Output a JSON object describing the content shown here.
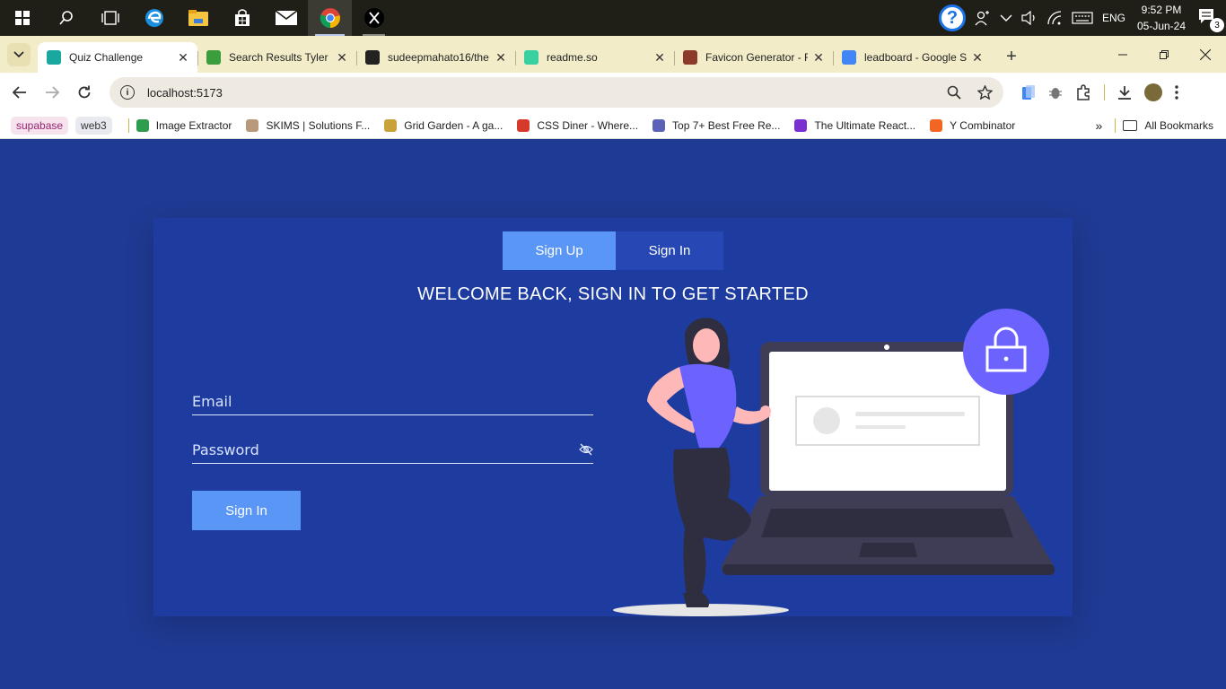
{
  "taskbar": {
    "apps": [
      "start-icon",
      "search-icon",
      "task-view-icon",
      "edge-icon",
      "file-explorer-icon",
      "store-icon",
      "mail-icon",
      "chrome-icon",
      "x-icon"
    ],
    "language": "ENG",
    "time": "9:52 PM",
    "date": "05-Jun-24",
    "notification_count": "3"
  },
  "tabs": [
    {
      "title": "Quiz Challenge",
      "active": true,
      "favicon_color": "#19a8a0"
    },
    {
      "title": "Search Results Tyler P",
      "active": false,
      "favicon_color": "#3c9d3c"
    },
    {
      "title": "sudeepmahato16/the",
      "active": false,
      "favicon_color": "#222222"
    },
    {
      "title": "readme.so",
      "active": false,
      "favicon_color": "#3ad0a0"
    },
    {
      "title": "Favicon Generator - F",
      "active": false,
      "favicon_color": "#8b3a2b"
    },
    {
      "title": "leadboard - Google S",
      "active": false,
      "favicon_color": "#4285f4"
    }
  ],
  "address": {
    "url": "localhost:5173"
  },
  "bookmarks": {
    "chips": [
      "supabase",
      "web3"
    ],
    "items": [
      {
        "label": "Image Extractor",
        "color": "#2e9d4e"
      },
      {
        "label": "SKIMS | Solutions F...",
        "color": "#b89a7a"
      },
      {
        "label": "Grid Garden - A ga...",
        "color": "#c9a33a"
      },
      {
        "label": "CSS Diner - Where...",
        "color": "#d63a2a"
      },
      {
        "label": "Top 7+ Best Free Re...",
        "color": "#5a62b8"
      },
      {
        "label": "The Ultimate React...",
        "color": "#7a2fd0"
      },
      {
        "label": "Y Combinator",
        "color": "#f26522"
      }
    ],
    "more": "»",
    "all_label": "All Bookmarks"
  },
  "auth": {
    "signup_tab": "Sign Up",
    "signin_tab": "Sign In",
    "heading": "WELCOME BACK, SIGN IN TO GET STARTED",
    "email_placeholder": "Email",
    "password_placeholder": "Password",
    "submit_label": "Sign In"
  },
  "colors": {
    "page_bg": "#1f3a93",
    "card_bg": "#1e3ca0",
    "accent": "#5a96f6",
    "illustration_accent": "#6c63ff"
  }
}
